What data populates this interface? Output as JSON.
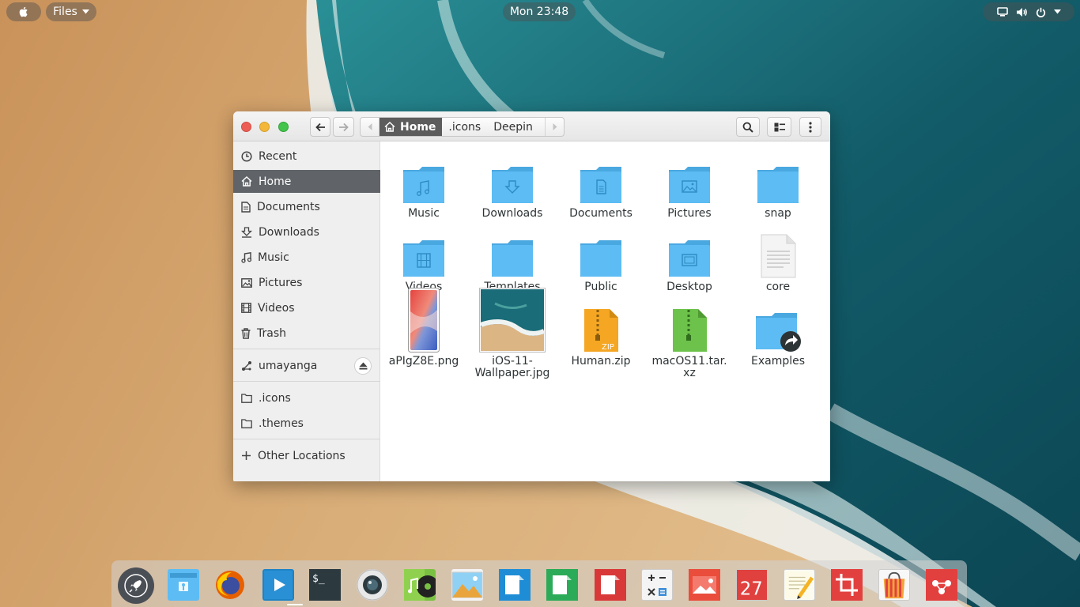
{
  "topbar": {
    "app_menu_label": "Files",
    "clock": "Mon 23:48",
    "icons": [
      "apple-icon",
      "chevron-down-icon",
      "screen-icon",
      "volume-icon",
      "power-icon",
      "chevron-down-icon"
    ]
  },
  "window": {
    "traffic_lights": [
      "close",
      "minimize",
      "maximize"
    ],
    "pathbar": {
      "crumbs": [
        "Home",
        ".icons",
        "Deepin"
      ],
      "active_index": 0
    },
    "header_buttons": [
      "back-icon",
      "forward-icon",
      "search-icon",
      "view-toggle-icon",
      "kebab-menu-icon"
    ]
  },
  "sidebar": {
    "items": [
      {
        "label": "Recent",
        "icon": "clock-icon",
        "selected": false
      },
      {
        "label": "Home",
        "icon": "home-icon",
        "selected": true
      },
      {
        "label": "Documents",
        "icon": "document-icon",
        "selected": false
      },
      {
        "label": "Downloads",
        "icon": "download-icon",
        "selected": false
      },
      {
        "label": "Music",
        "icon": "music-icon",
        "selected": false
      },
      {
        "label": "Pictures",
        "icon": "picture-icon",
        "selected": false
      },
      {
        "label": "Videos",
        "icon": "film-icon",
        "selected": false
      },
      {
        "label": "Trash",
        "icon": "trash-icon",
        "selected": false
      }
    ],
    "device": {
      "label": "umayanga",
      "icon": "network-share-icon",
      "action_icon": "eject-icon"
    },
    "bookmarks": [
      {
        "label": ".icons",
        "icon": "folder-outline-icon"
      },
      {
        "label": ".themes",
        "icon": "folder-outline-icon"
      }
    ],
    "other_locations": {
      "label": "Other Locations",
      "icon": "plus-icon"
    }
  },
  "content": {
    "files": [
      {
        "name": "Music",
        "kind": "folder",
        "emblem": "music"
      },
      {
        "name": "Downloads",
        "kind": "folder",
        "emblem": "download"
      },
      {
        "name": "Documents",
        "kind": "folder",
        "emblem": "document"
      },
      {
        "name": "Pictures",
        "kind": "folder",
        "emblem": "picture"
      },
      {
        "name": "snap",
        "kind": "folder",
        "emblem": ""
      },
      {
        "name": "Videos",
        "kind": "folder",
        "emblem": "film"
      },
      {
        "name": "Templates",
        "kind": "folder",
        "emblem": ""
      },
      {
        "name": "Public",
        "kind": "folder",
        "emblem": ""
      },
      {
        "name": "Desktop",
        "kind": "folder",
        "emblem": "desktop"
      },
      {
        "name": "core",
        "kind": "text-file",
        "emblem": ""
      },
      {
        "name": "aPIgZ8E.png",
        "kind": "image-thumbnail",
        "emblem": ""
      },
      {
        "name": "iOS-11-Wallpaper.jpg",
        "kind": "image-thumbnail",
        "emblem": ""
      },
      {
        "name": "Human.zip",
        "kind": "zip-archive",
        "emblem": "ZIP"
      },
      {
        "name": "macOS11.tar.xz",
        "kind": "xz-archive",
        "emblem": ""
      },
      {
        "name": "Examples",
        "kind": "folder-link",
        "emblem": "link"
      }
    ],
    "label_lines": {
      "ios_line1": "iOS-11-",
      "ios_line2": "Wallpaper.jpg",
      "mac_line1": "macOS11.tar.",
      "mac_line2": "xz"
    }
  },
  "dock": {
    "apps": [
      "launcher-icon",
      "files-app-icon",
      "firefox-icon",
      "video-player-icon",
      "terminal-icon",
      "screenshot-camera-icon",
      "music-player-icon",
      "image-viewer-icon",
      "writer-icon",
      "spreadsheet-icon",
      "presentation-icon",
      "calculator-icon",
      "photo-app-icon",
      "calendar-icon",
      "text-editor-icon",
      "crop-tool-icon",
      "app-store-icon",
      "software-center-icon"
    ],
    "calendar_day": "27",
    "terminal_prompt": "$_"
  },
  "colors": {
    "folder_blue": "#5cbcf3",
    "selection_gray": "#606468",
    "close_red": "#ec5e55",
    "minimize_yellow": "#f3b73a",
    "maximize_green": "#43c44c"
  }
}
